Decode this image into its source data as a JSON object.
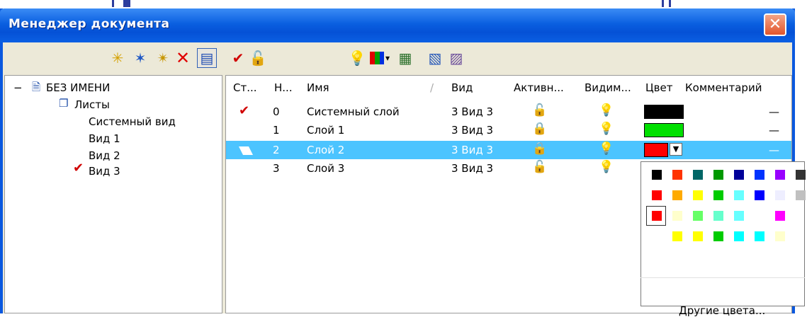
{
  "window": {
    "title": "Менеджер документа",
    "close_glyph": "✕"
  },
  "toolbar": {
    "icons": [
      "new-layer-icon",
      "new-layers-icon",
      "filter-layer-icon",
      "delete-icon",
      "properties-icon",
      "apply-icon",
      "unlock-icon",
      "lightbulb-icon",
      "color-icon",
      "dropdown-arrow-icon",
      "layer-settings-icon",
      "layer-move-icon",
      "layer-copy-icon"
    ]
  },
  "tree": {
    "collapse": "−",
    "root": "БЕЗ ИМЕНИ",
    "sheets": "Листы",
    "views": [
      "Системный вид",
      "Вид 1",
      "Вид 2",
      "Вид 3"
    ]
  },
  "columns": [
    "Ст...",
    "Н...",
    "Имя",
    "Вид",
    "Активн...",
    "Видим...",
    "Цвет",
    "Комментарий"
  ],
  "rows": [
    {
      "num": "0",
      "name": "Системный слой",
      "view": "3 Вид 3",
      "comment": "—",
      "color": "#000000"
    },
    {
      "num": "1",
      "name": "Слой 1",
      "view": "3 Вид 3",
      "comment": "—",
      "color": "#00e000"
    },
    {
      "num": "2",
      "name": "Слой 2",
      "view": "3 Вид 3",
      "comment": "—",
      "color": "#ff0000"
    },
    {
      "num": "3",
      "name": "Слой 3",
      "view": "3 Вид 3",
      "comment": "",
      "color": ""
    }
  ],
  "palette": {
    "row1": [
      "#000000",
      "#ff3300",
      "#006666",
      "#009900",
      "#000099",
      "#0033ff",
      "#9900ff",
      "#333333"
    ],
    "row2": [
      "#ff0000",
      "#ffaa00",
      "#ffff00",
      "#00cc00",
      "#66ffff",
      "#0000ff",
      "#eeeeff",
      "#c0c0c0"
    ],
    "row3": [
      "#ff0000",
      "#ffffcc",
      "#66ff66",
      "#66ffcc",
      "#66ffff",
      "#ffffff",
      "#ff00ff",
      "#ffffff"
    ],
    "row4": [
      "#ffffff",
      "#ffff00",
      "#ffff00",
      "#00cc00",
      "#00ffff",
      "#00ffff",
      "#ffffcc",
      "#ffffff"
    ],
    "other_colors": "Другие цвета..."
  }
}
